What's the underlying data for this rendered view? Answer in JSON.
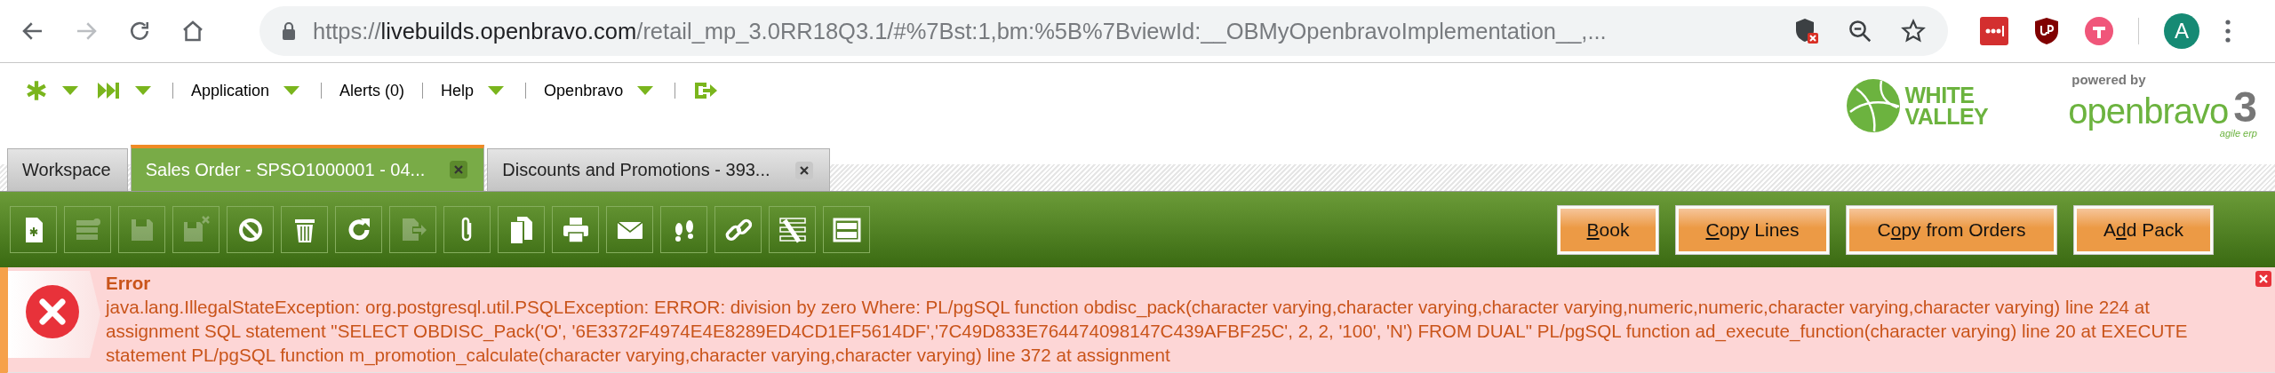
{
  "browser": {
    "nav": [
      {
        "kind": "back",
        "disabled": false
      },
      {
        "kind": "forward",
        "disabled": true
      },
      {
        "kind": "reload",
        "disabled": false
      },
      {
        "kind": "home",
        "disabled": false
      }
    ],
    "url": {
      "scheme": "https://",
      "host": "livebuilds.openbravo.com",
      "path": "/retail_mp_3.0RR18Q3.1/#%7Bst:1,bm:%5B%7BviewId:__OBMyOpenbravoImplementation__,..."
    },
    "extensions": [
      {
        "kind": "dots"
      },
      {
        "kind": "shield"
      },
      {
        "kind": "t"
      }
    ],
    "avatar": "A"
  },
  "menu": {
    "items": [
      {
        "kind": "asterisk",
        "dropdown": true
      },
      {
        "kind": "forward",
        "dropdown": true
      },
      {
        "kind": "text",
        "label": "Application",
        "dropdown": true
      },
      {
        "kind": "text",
        "label": "Alerts (0)",
        "dropdown": false
      },
      {
        "kind": "text",
        "label": "Help",
        "dropdown": true
      },
      {
        "kind": "text",
        "label": "Openbravo",
        "dropdown": true
      },
      {
        "kind": "logout",
        "dropdown": false
      }
    ],
    "logos": {
      "client": [
        "WHITE",
        "VALLEY"
      ],
      "powered_by": "powered by",
      "brand": "openbravo",
      "version": "3",
      "tagline": "agile erp"
    }
  },
  "tabs": [
    {
      "label": "Workspace",
      "selected": false,
      "closable": false
    },
    {
      "label": "Sales Order - SPSO1000001 - 04...",
      "selected": true,
      "closable": true
    },
    {
      "label": "Discounts and Promotions - 393...",
      "selected": false,
      "closable": true
    }
  ],
  "toolbar": {
    "icons": [
      {
        "kind": "new",
        "disabled": false
      },
      {
        "kind": "grid",
        "disabled": true
      },
      {
        "kind": "save",
        "disabled": true
      },
      {
        "kind": "save-close",
        "disabled": true
      },
      {
        "kind": "cancel",
        "disabled": false
      },
      {
        "kind": "delete",
        "disabled": false
      },
      {
        "kind": "refresh",
        "disabled": false
      },
      {
        "kind": "export",
        "disabled": true
      },
      {
        "kind": "attach",
        "disabled": false
      },
      {
        "kind": "copy",
        "disabled": false
      },
      {
        "kind": "print",
        "disabled": false
      },
      {
        "kind": "email",
        "disabled": false
      },
      {
        "kind": "audit",
        "disabled": false
      },
      {
        "kind": "link",
        "disabled": false
      },
      {
        "kind": "tools",
        "disabled": false
      },
      {
        "kind": "view",
        "disabled": false
      }
    ],
    "buttons": [
      {
        "label_parts": [
          {
            "text": "B",
            "underlined": true
          },
          {
            "text": "ook",
            "underlined": false
          }
        ]
      },
      {
        "label_parts": [
          {
            "text": "C",
            "underlined": true
          },
          {
            "text": "opy Lines",
            "underlined": false
          }
        ]
      },
      {
        "label_parts": [
          {
            "text": "C",
            "underlined": false
          },
          {
            "text": "o",
            "underlined": true
          },
          {
            "text": "py from Orders",
            "underlined": false
          }
        ]
      },
      {
        "label_parts": [
          {
            "text": "A",
            "underlined": false
          },
          {
            "text": "d",
            "underlined": true
          },
          {
            "text": "d Pack",
            "underlined": false
          }
        ]
      }
    ]
  },
  "message": {
    "title": "Error",
    "text": "java.lang.IllegalStateException: org.postgresql.util.PSQLException: ERROR: division by zero Where: PL/pgSQL function obdisc_pack(character varying,character varying,character varying,numeric,numeric,character varying,character varying) line 224 at assignment SQL statement \"SELECT OBDISC_Pack('O', '6E3372F4974E4E8289ED4CD1EF5614DF','7C49D833E764474098147C439AFBF25C', 2, 2, '100', 'N') FROM DUAL\" PL/pgSQL function ad_execute_function(character varying) line 20 at EXECUTE statement PL/pgSQL function m_promotion_calculate(character varying,character varying,character varying) line 372 at assignment"
  }
}
